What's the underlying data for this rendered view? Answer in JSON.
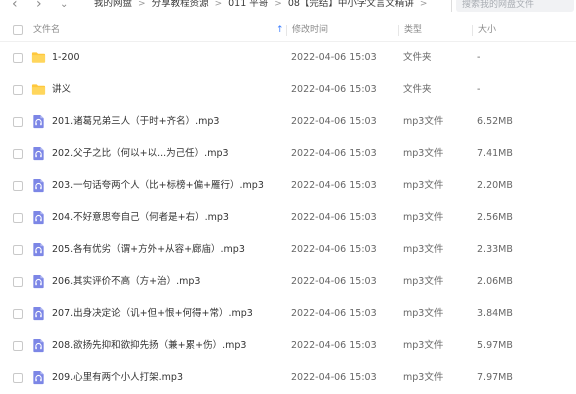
{
  "toolbar": {
    "back": "‹",
    "forward": "›",
    "search_placeholder": "搜索我的网盘文件"
  },
  "breadcrumb": [
    "我的网盘",
    "分享教程资源",
    "011 平哥",
    "08【完结】中小学文言文精讲"
  ],
  "breadcrumb_separator": ">",
  "columns": {
    "name": "文件名",
    "modified": "修改时间",
    "type": "类型",
    "size": "大小"
  },
  "files": [
    {
      "name": "1-200",
      "modified": "2022-04-06 15:03",
      "type": "文件夹",
      "size": "-",
      "icon": "folder-icon"
    },
    {
      "name": "讲义",
      "modified": "2022-04-06 15:03",
      "type": "文件夹",
      "size": "-",
      "icon": "folder-icon"
    },
    {
      "name": "201.诸葛兄弟三人（于时+齐名）.mp3",
      "modified": "2022-04-06 15:03",
      "type": "mp3文件",
      "size": "6.52MB",
      "icon": "audio-file-icon"
    },
    {
      "name": "202.父子之比（何以+以...为己任）.mp3",
      "modified": "2022-04-06 15:03",
      "type": "mp3文件",
      "size": "7.41MB",
      "icon": "audio-file-icon"
    },
    {
      "name": "203.一句话夸两个人（比+标榜+偏+雁行）.mp3",
      "modified": "2022-04-06 15:03",
      "type": "mp3文件",
      "size": "2.20MB",
      "icon": "audio-file-icon"
    },
    {
      "name": "204.不好意思夸自己（何者是+右）.mp3",
      "modified": "2022-04-06 15:03",
      "type": "mp3文件",
      "size": "2.56MB",
      "icon": "audio-file-icon"
    },
    {
      "name": "205.各有优劣（谓+方外+从容+廊庙）.mp3",
      "modified": "2022-04-06 15:03",
      "type": "mp3文件",
      "size": "2.33MB",
      "icon": "audio-file-icon"
    },
    {
      "name": "206.其实评价不高（方+治）.mp3",
      "modified": "2022-04-06 15:03",
      "type": "mp3文件",
      "size": "2.06MB",
      "icon": "audio-file-icon"
    },
    {
      "name": "207.出身决定论（讥+但+恨+何得+常）.mp3",
      "modified": "2022-04-06 15:03",
      "type": "mp3文件",
      "size": "3.84MB",
      "icon": "audio-file-icon"
    },
    {
      "name": "208.欲扬先抑和欲抑先扬（兼+累+伤）.mp3",
      "modified": "2022-04-06 15:03",
      "type": "mp3文件",
      "size": "5.97MB",
      "icon": "audio-file-icon"
    },
    {
      "name": "209.心里有两个小人打架.mp3",
      "modified": "2022-04-06 15:03",
      "type": "mp3文件",
      "size": "7.97MB",
      "icon": "audio-file-icon"
    }
  ],
  "colors": {
    "folder": "#ffc83d",
    "audio": "#7c86e6",
    "sort_arrow": "#3b7cff"
  }
}
